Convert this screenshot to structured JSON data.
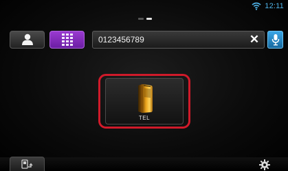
{
  "status": {
    "time": "12:11",
    "wifi_icon": "wifi-icon",
    "accent_color": "#4fb3e8"
  },
  "page_indicator": {
    "pages": 2,
    "active_page": 2
  },
  "toolbar": {
    "contacts_icon": "person-icon",
    "keypad_icon": "keypad-icon",
    "number_value": "0123456789",
    "clear_label": "✕",
    "voice_icon": "microphone-icon",
    "keypad_color": "#8a2fc4",
    "voice_color": "#2a8fd0"
  },
  "main": {
    "tel_label": "TEL",
    "tel_icon": "mobile-phone-icon",
    "highlight_color": "#d01a2a"
  },
  "bottom": {
    "back_icon": "phone-back-icon",
    "settings_icon": "gear-icon"
  }
}
